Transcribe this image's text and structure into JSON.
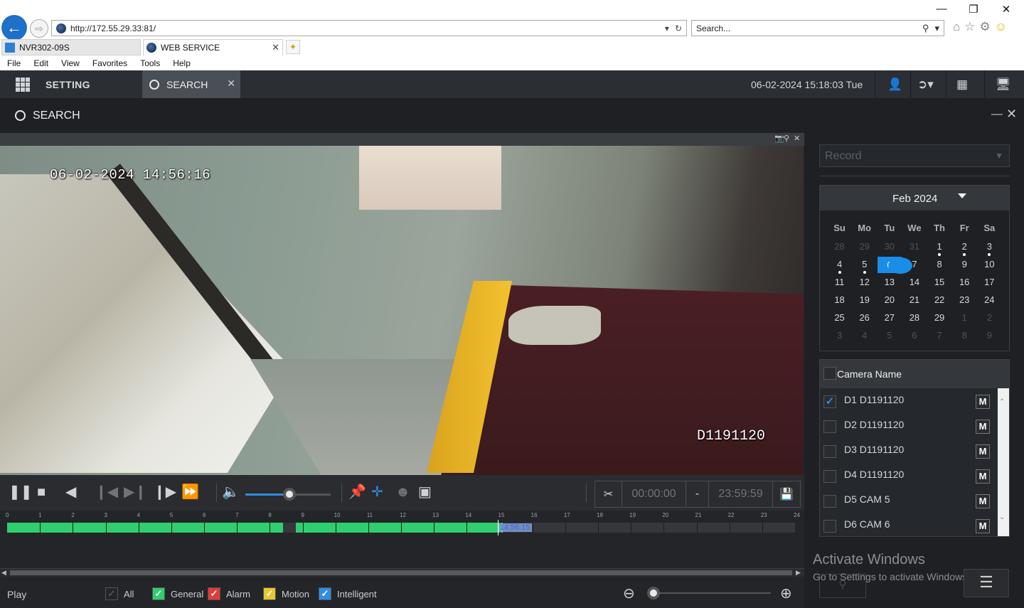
{
  "browser": {
    "address": "http://172.55.29.33:81/",
    "search_placeholder": "Search...",
    "tabs": [
      {
        "label": "NVR302-09S",
        "active": false
      },
      {
        "label": "WEB SERVICE",
        "active": true
      }
    ],
    "menu": [
      "File",
      "Edit",
      "View",
      "Favorites",
      "Tools",
      "Help"
    ]
  },
  "app_header": {
    "setting_label": "SETTING",
    "search_tab_label": "SEARCH",
    "datetime": "06-02-2024 15:18:03 Tue"
  },
  "page": {
    "title": "SEARCH"
  },
  "video": {
    "osd_time": "06-02-2024 14:56:16",
    "osd_camera": "D1191120"
  },
  "controls": {
    "volume": 0.52,
    "clip_start": "00:00:00",
    "clip_sep": "-",
    "clip_end": "23:59:59"
  },
  "timeline": {
    "hours": [
      "0",
      "1",
      "2",
      "3",
      "4",
      "5",
      "6",
      "7",
      "8",
      "9",
      "10",
      "11",
      "12",
      "13",
      "14",
      "15",
      "16",
      "17",
      "18",
      "19",
      "20",
      "21",
      "22",
      "23",
      "24"
    ],
    "recorded_ranges": [
      [
        0,
        8.4
      ],
      [
        8.8,
        15.1
      ]
    ],
    "cursor_hour": 14.94,
    "cursor_label": "14:56:15"
  },
  "legend": {
    "play_label": "Play",
    "items": [
      {
        "label": "All",
        "checked": true,
        "color": "#232529"
      },
      {
        "label": "General",
        "checked": true,
        "color": "#2fce6e"
      },
      {
        "label": "Alarm",
        "checked": true,
        "color": "#e23b3b"
      },
      {
        "label": "Motion",
        "checked": true,
        "color": "#e6c72f"
      },
      {
        "label": "Intelligent",
        "checked": true,
        "color": "#2f8de4"
      }
    ],
    "zoom_level": 0.0
  },
  "right_panel": {
    "record_type": "Record",
    "calendar": {
      "month": "Feb 2024",
      "weekdays": [
        "Su",
        "Mo",
        "Tu",
        "We",
        "Th",
        "Fr",
        "Sa"
      ],
      "weeks": [
        [
          {
            "d": "28",
            "m": true
          },
          {
            "d": "29",
            "m": true
          },
          {
            "d": "30",
            "m": true
          },
          {
            "d": "31",
            "m": true
          },
          {
            "d": "1",
            "dot": true
          },
          {
            "d": "2",
            "dot": true
          },
          {
            "d": "3",
            "dot": true
          }
        ],
        [
          {
            "d": "4",
            "dot": true
          },
          {
            "d": "5",
            "dot": true
          },
          {
            "d": "6",
            "dot": true,
            "sel": true
          },
          {
            "d": "7"
          },
          {
            "d": "8"
          },
          {
            "d": "9"
          },
          {
            "d": "10"
          }
        ],
        [
          {
            "d": "11"
          },
          {
            "d": "12"
          },
          {
            "d": "13"
          },
          {
            "d": "14"
          },
          {
            "d": "15"
          },
          {
            "d": "16"
          },
          {
            "d": "17"
          }
        ],
        [
          {
            "d": "18"
          },
          {
            "d": "19"
          },
          {
            "d": "20"
          },
          {
            "d": "21"
          },
          {
            "d": "22"
          },
          {
            "d": "23"
          },
          {
            "d": "24"
          }
        ],
        [
          {
            "d": "25"
          },
          {
            "d": "26"
          },
          {
            "d": "27"
          },
          {
            "d": "28"
          },
          {
            "d": "29"
          },
          {
            "d": "1",
            "m": true
          },
          {
            "d": "2",
            "m": true
          }
        ],
        [
          {
            "d": "3",
            "m": true
          },
          {
            "d": "4",
            "m": true
          },
          {
            "d": "5",
            "m": true
          },
          {
            "d": "6",
            "m": true
          },
          {
            "d": "7",
            "m": true
          },
          {
            "d": "8",
            "m": true
          },
          {
            "d": "9",
            "m": true
          }
        ]
      ]
    },
    "camera_header": "Camera Name",
    "cameras": [
      {
        "name": "D1 D1191120",
        "checked": true,
        "mode": "M"
      },
      {
        "name": "D2 D1191120",
        "checked": false,
        "mode": "M"
      },
      {
        "name": "D3 D1191120",
        "checked": false,
        "mode": "M"
      },
      {
        "name": "D4 D1191120",
        "checked": false,
        "mode": "M"
      },
      {
        "name": "D5 CAM 5",
        "checked": false,
        "mode": "M"
      },
      {
        "name": "D6 CAM 6",
        "checked": false,
        "mode": "M"
      }
    ],
    "watermark_title": "Activate Windows",
    "watermark_sub": "Go to Settings to activate Windows."
  }
}
